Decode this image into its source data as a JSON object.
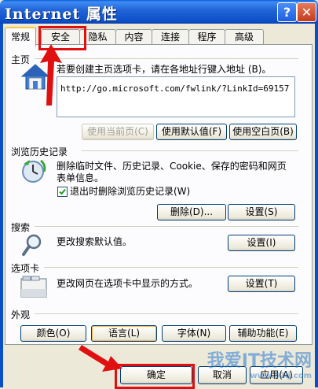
{
  "window": {
    "title": "Internet 属性",
    "help_label": "?",
    "close_label": "✕"
  },
  "tabs": [
    {
      "label": "常规"
    },
    {
      "label": "安全"
    },
    {
      "label": "隐私"
    },
    {
      "label": "内容"
    },
    {
      "label": "连接"
    },
    {
      "label": "程序"
    },
    {
      "label": "高级"
    }
  ],
  "homepage": {
    "title": "主页",
    "description": "若要创建主页选项卡，请在各地址行键入地址 (B)。",
    "url": "http://go.microsoft.com/fwlink/?LinkId=69157",
    "use_current": "使用当前页(C)",
    "use_default": "使用默认值(F)",
    "use_blank": "使用空白页(B)"
  },
  "history": {
    "title": "浏览历史记录",
    "description_line1": "删除临时文件、历史记录、Cookie、保存的密码和网页",
    "description_line2": "表单信息。",
    "checkbox_label": "退出时删除浏览历史记录(W)",
    "checkbox_checked": true,
    "delete_button": "删除(D)...",
    "settings_button": "设置(S)"
  },
  "search": {
    "title": "搜索",
    "description": "更改搜索默认值。",
    "settings_button": "设置(I)"
  },
  "tabs_group": {
    "title": "选项卡",
    "description": "更改网页在选项卡中显示的方式。",
    "settings_button": "设置(T)"
  },
  "appearance": {
    "title": "外观",
    "colors": "颜色(O)",
    "languages": "语言(L)",
    "fonts": "字体(N)",
    "accessibility": "辅助功能(E)"
  },
  "footer": {
    "ok": "确定",
    "cancel": "取消",
    "apply": "应用(A)"
  },
  "watermark": {
    "text": "我爱IT技术网",
    "url": "www.52ij.com"
  },
  "colors": {
    "title_bar": "#0b4fc7",
    "annotation_red": "#e01010"
  }
}
